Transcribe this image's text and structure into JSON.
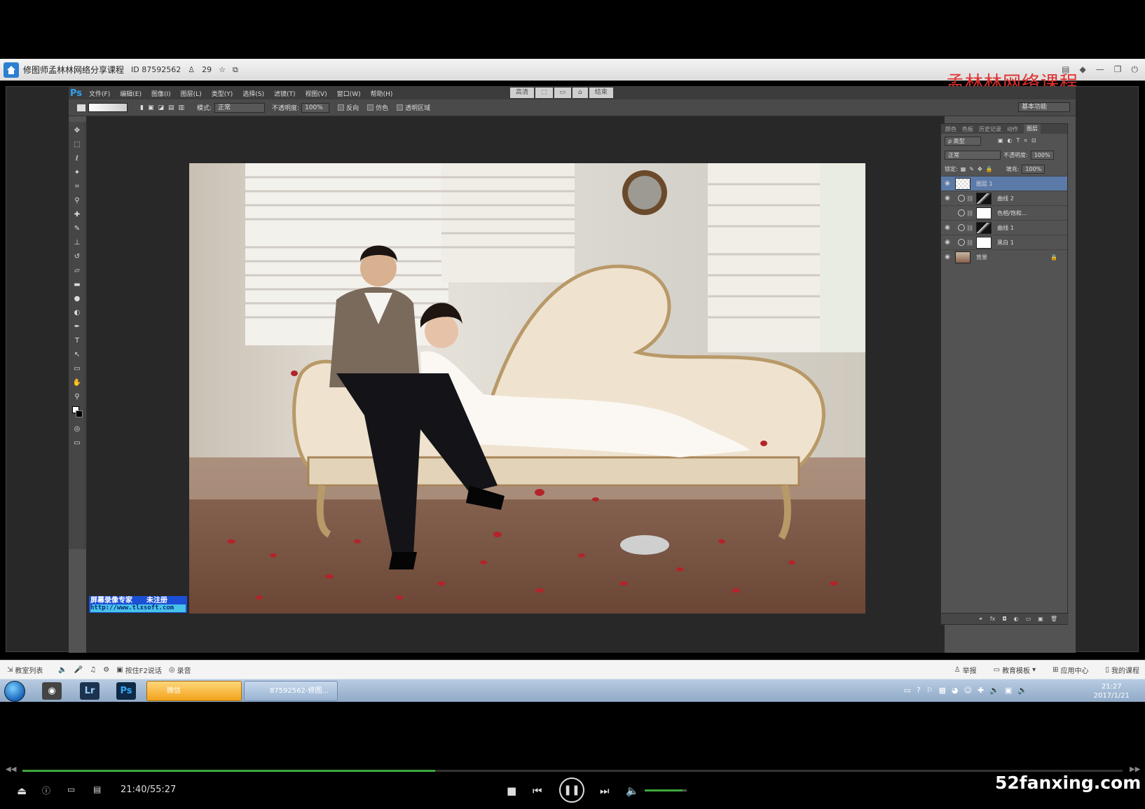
{
  "classroom": {
    "title": "修图师孟林林网络分享课程",
    "room_id": "ID 87592562",
    "online_count": "29",
    "brand_overlay": "孟林林网络课程"
  },
  "photoshop": {
    "logo": "Ps",
    "menu": [
      "文件(F)",
      "编辑(E)",
      "图像(I)",
      "图层(L)",
      "类型(Y)",
      "选择(S)",
      "滤镜(T)",
      "视图(V)",
      "窗口(W)",
      "帮助(H)"
    ],
    "workspace_buttons": [
      "高清",
      "",
      "",
      "",
      "结束"
    ],
    "options": {
      "mode_label": "模式:",
      "mode_value": "正常",
      "opacity_label": "不透明度:",
      "opacity_value": "100%",
      "reverse_label": "反向",
      "dither_label": "仿色",
      "transparency_label": "透明区域",
      "workspace_value": "基本功能"
    },
    "tools": [
      "move",
      "marquee",
      "lasso",
      "magic-wand",
      "crop",
      "eyedropper",
      "healing",
      "brush",
      "stamp",
      "history-brush",
      "eraser",
      "gradient",
      "blur",
      "dodge",
      "pen",
      "type",
      "path-select",
      "shape",
      "hand",
      "zoom"
    ],
    "layers_panel": {
      "tabs": [
        "颜色",
        "色板",
        "历史记录",
        "动作",
        "图层"
      ],
      "active_tab": "图层",
      "filter_value": "ρ 类型",
      "blend_mode": "正常",
      "opacity_label": "不透明度:",
      "opacity_value": "100%",
      "lock_label": "锁定:",
      "fill_label": "填充:",
      "fill_value": "100%",
      "layers": [
        {
          "name": "图层 1",
          "thumb": "check",
          "visible": true,
          "active": true,
          "adjust": false
        },
        {
          "name": "曲线 2",
          "thumb": "curve",
          "visible": true,
          "active": false,
          "adjust": true
        },
        {
          "name": "色相/饱和...",
          "thumb": "white",
          "visible": false,
          "active": false,
          "adjust": true
        },
        {
          "name": "曲线 1",
          "thumb": "curve",
          "visible": true,
          "active": false,
          "adjust": true
        },
        {
          "name": "黑白 1",
          "thumb": "white",
          "visible": true,
          "active": false,
          "adjust": true
        },
        {
          "name": "背景",
          "thumb": "photo",
          "visible": true,
          "active": false,
          "adjust": false
        }
      ]
    }
  },
  "recorder_watermark": {
    "line1": "屏幕录像专家　　未注册",
    "line2": "http://www.tlxsoft.com"
  },
  "classroom_toolbar": {
    "left": [
      "教室列表",
      "按住F2说话",
      "录音"
    ],
    "right": [
      "举报",
      "教育模板",
      "应用中心",
      "我的课程"
    ]
  },
  "taskbar": {
    "apps": [
      "Lr",
      "Ps"
    ],
    "wechat_label": "微信",
    "task_label": "87592562-修图...",
    "time": "21:27",
    "date": "2017/1/21"
  },
  "player": {
    "timecode": "21:40/55:27",
    "progress": 0.375,
    "volume": 0.9,
    "site": "52fanxing.com"
  }
}
